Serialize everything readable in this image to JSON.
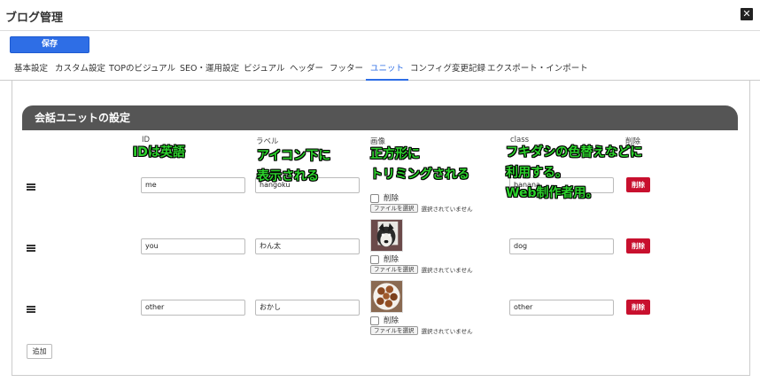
{
  "window": {
    "title": "ブログ管理",
    "close_label": "✕"
  },
  "toolbar": {
    "save_label": "保存"
  },
  "tabs": [
    {
      "label": "基本設定"
    },
    {
      "label": "カスタム設定"
    },
    {
      "label": "TOPのビジュアル"
    },
    {
      "label": "SEO・運用設定"
    },
    {
      "label": "ビジュアル"
    },
    {
      "label": "ヘッダー"
    },
    {
      "label": "フッター"
    },
    {
      "label": "ユニット",
      "active": true
    },
    {
      "label": "コンフィグ変更記録"
    },
    {
      "label": "エクスポート・インポート"
    }
  ],
  "section": {
    "title": "会話ユニットの設定"
  },
  "columns": {
    "id": "ID",
    "label": "ラベル",
    "image": "画像",
    "class": "class",
    "delete": "削除"
  },
  "rows": [
    {
      "id": "me",
      "label": "hangoku",
      "class": "banana",
      "has_image": false
    },
    {
      "id": "you",
      "label": "わん太",
      "class": "dog",
      "has_image": true,
      "image_icon": "dog-photo-icon"
    },
    {
      "id": "other",
      "label": "おかし",
      "class": "other",
      "has_image": true,
      "image_icon": "cookies-photo-icon"
    }
  ],
  "row_controls": {
    "delete_checkbox_label": "削除",
    "file_button_label": "ファイルを選択",
    "file_state": "選択されていません",
    "delete_button_label": "削除"
  },
  "add_label": "追加",
  "annotations": {
    "id_note": "IDは英語",
    "label_note_1": "アイコン下に",
    "label_note_2": "表示される",
    "image_note_1": "正方形に",
    "image_note_2": "トリミングされる",
    "class_note_1": "フキダシの色替えなどに",
    "class_note_2": "利用する。",
    "class_note_3": "Web制作者用。"
  },
  "colors": {
    "accent": "#2e6ee6",
    "danger": "#c8102e",
    "header_bg": "#555555",
    "note_green": "#2cd12c"
  }
}
